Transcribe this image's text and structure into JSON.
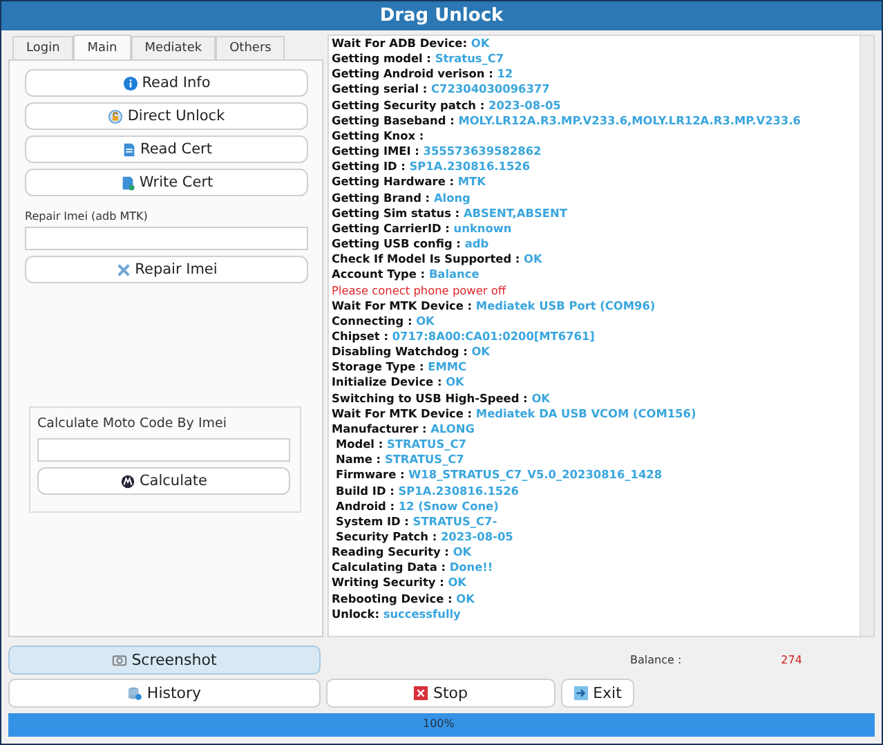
{
  "window": {
    "title": "Drag Unlock"
  },
  "tabs": [
    {
      "label": "Login",
      "selected": false
    },
    {
      "label": "Main",
      "selected": true
    },
    {
      "label": "Mediatek",
      "selected": false
    },
    {
      "label": "Others",
      "selected": false
    }
  ],
  "actions": [
    {
      "label": "Read Info"
    },
    {
      "label": "Direct Unlock"
    },
    {
      "label": "Read Cert"
    },
    {
      "label": "Write Cert"
    }
  ],
  "repair": {
    "label": "Repair Imei (adb MTK)",
    "button": "Repair Imei"
  },
  "moto": {
    "title": "Calculate Moto Code By Imei",
    "button": "Calculate"
  },
  "log": [
    {
      "label": "Wait For ADB Device:",
      "value": "OK",
      "kind": "pair"
    },
    {
      "label": "Getting model :",
      "value": "Stratus_C7",
      "kind": "pair"
    },
    {
      "label": "Getting Android verison :",
      "value": "12",
      "kind": "pair"
    },
    {
      "label": "Getting serial :",
      "value": "C72304030096377",
      "kind": "pair"
    },
    {
      "label": "Getting Security patch :",
      "value": "2023-08-05",
      "kind": "pair"
    },
    {
      "label": "Getting Baseband :",
      "value": "MOLY.LR12A.R3.MP.V233.6,MOLY.LR12A.R3.MP.V233.6",
      "kind": "pair"
    },
    {
      "label": "Getting Knox :",
      "kind": "pair"
    },
    {
      "label": "Getting IMEI :",
      "value": "355573639582862",
      "kind": "pair"
    },
    {
      "label": "Getting ID :",
      "value": "SP1A.230816.1526",
      "kind": "pair"
    },
    {
      "label": "Getting Hardware :",
      "value": "MTK",
      "kind": "pair"
    },
    {
      "label": "Getting Brand :",
      "value": "Along",
      "kind": "pair"
    },
    {
      "label": "Getting Sim status :",
      "value": "ABSENT,ABSENT",
      "kind": "pair"
    },
    {
      "label": "Getting CarrierID :",
      "value": "unknown",
      "kind": "pair"
    },
    {
      "label": "Getting USB config :",
      "value": "adb",
      "kind": "pair"
    },
    {
      "label": "Check If Model Is Supported :",
      "value": "OK",
      "kind": "pair"
    },
    {
      "label": "Account Type :",
      "value": "Balance",
      "kind": "pair"
    },
    {
      "label": "Please conect phone power off",
      "kind": "error"
    },
    {
      "label": "Wait For MTK Device :",
      "value": "Mediatek USB Port (COM96)",
      "kind": "pair"
    },
    {
      "label": "Connecting :",
      "value": "OK",
      "kind": "pair"
    },
    {
      "label": "Chipset :",
      "value": "0717:8A00:CA01:0200[MT6761]",
      "kind": "pair"
    },
    {
      "label": "Disabling Watchdog :",
      "value": "OK",
      "kind": "pair"
    },
    {
      "label": "Storage Type :",
      "value": "EMMC",
      "kind": "pair"
    },
    {
      "label": "Initialize Device :",
      "value": "OK",
      "kind": "pair"
    },
    {
      "label": "Switching to USB High-Speed :",
      "value": "OK",
      "kind": "pair"
    },
    {
      "label": "Wait For MTK Device :",
      "value": "Mediatek DA USB VCOM (COM156)",
      "kind": "pair"
    },
    {
      "label": "Manufacturer :",
      "value": "ALONG",
      "kind": "pair"
    },
    {
      "label": "Model :",
      "value": "STRATUS_C7",
      "kind": "sub"
    },
    {
      "label": "Name :",
      "value": "STRATUS_C7",
      "kind": "sub"
    },
    {
      "label": "Firmware :",
      "value": "W18_STRATUS_C7_V5.0_20230816_1428",
      "kind": "sub"
    },
    {
      "label": "Build ID :",
      "value": "SP1A.230816.1526",
      "kind": "sub"
    },
    {
      "label": "Android :",
      "value": "12 (Snow Cone)",
      "kind": "sub"
    },
    {
      "label": "System ID :",
      "value": "STRATUS_C7-",
      "kind": "sub"
    },
    {
      "label": "Security Patch :",
      "value": "2023-08-05",
      "kind": "sub"
    },
    {
      "label": "Reading Security :",
      "value": "OK",
      "kind": "pair"
    },
    {
      "label": "Calculating Data :",
      "value": "Done!!",
      "kind": "pair"
    },
    {
      "label": "Writing Security :",
      "value": "OK",
      "kind": "pair"
    },
    {
      "label": "Rebooting Device :",
      "value": "OK",
      "kind": "pair"
    },
    {
      "label": "Unlock:",
      "value": "successfully",
      "kind": "pair"
    }
  ],
  "balance": {
    "label": "Balance :",
    "value": "274"
  },
  "screenshot_button": "Screenshot",
  "buttons": [
    "History",
    "Stop",
    "Exit"
  ],
  "progress": {
    "level": 1,
    "label": "100%"
  }
}
